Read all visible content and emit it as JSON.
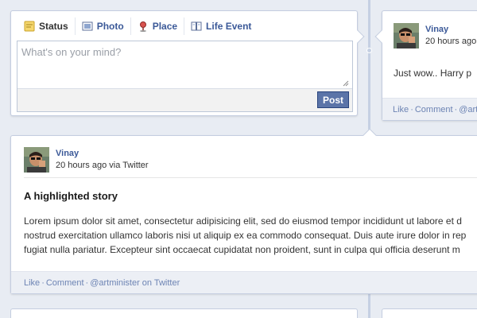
{
  "composer": {
    "tabs": [
      {
        "label": "Status",
        "icon": "status-icon",
        "active": true
      },
      {
        "label": "Photo",
        "icon": "photo-icon",
        "active": false
      },
      {
        "label": "Place",
        "icon": "place-icon",
        "active": false
      },
      {
        "label": "Life Event",
        "icon": "life-event-icon",
        "active": false
      }
    ],
    "placeholder": "What's on your mind?",
    "post_label": "Post"
  },
  "right_post": {
    "author": "Vinay",
    "time": "20 hours ago",
    "text": "Just wow.. Harry p",
    "footer": {
      "like": "Like",
      "comment": "Comment",
      "source": "@art"
    }
  },
  "story": {
    "author": "Vinay",
    "meta": "20 hours ago via Twitter",
    "headline": "A highlighted story",
    "body_lines": [
      "Lorem ipsum dolor sit amet, consectetur adipisicing elit, sed do eiusmod tempor incididunt ut labore et d",
      "nostrud exercitation ullamco laboris nisi ut aliquip ex ea commodo consequat. Duis aute irure dolor in rep",
      "fugiat nulla pariatur. Excepteur sint occaecat cupidatat non proident, sunt in culpa qui officia deserunt m"
    ],
    "footer": {
      "like": "Like",
      "comment": "Comment",
      "source": "@artminister on Twitter"
    }
  },
  "colors": {
    "background": "#e8ecf3",
    "link": "#3b5998",
    "post_button": "#5b74a8",
    "footer_bg": "#eceff5"
  }
}
